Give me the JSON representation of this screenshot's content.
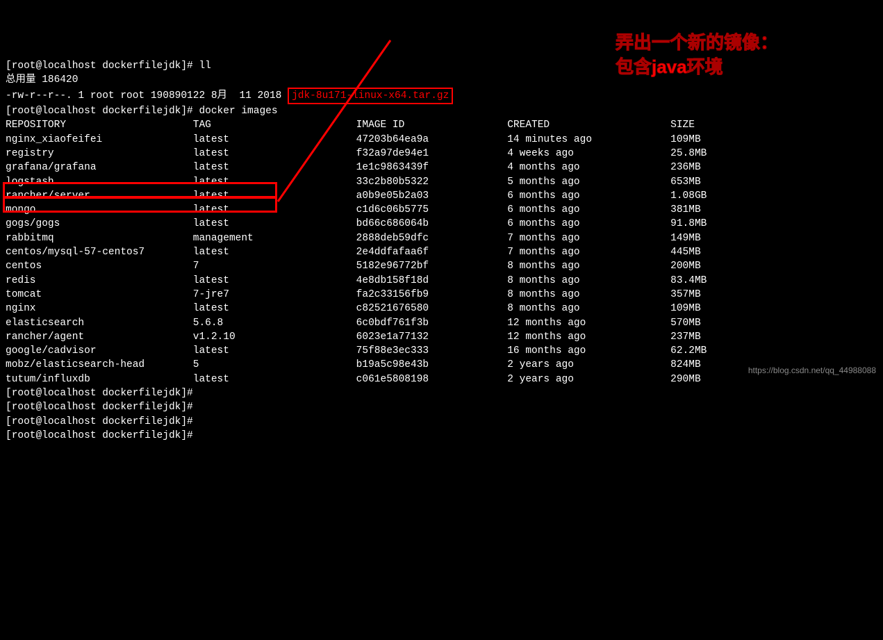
{
  "prompt1": "[root@localhost dockerfilejdk]# ",
  "cmd1": "ll",
  "total_line": "总用量 186420",
  "file_line_pre": "-rw-r--r--. 1 root root 190890122 8月  11 2018 ",
  "highlighted_file": "jdk-8u171-linux-x64.tar.gz",
  "prompt2": "[root@localhost dockerfilejdk]# ",
  "cmd2": "docker images",
  "header": {
    "col1": "REPOSITORY",
    "col2": "TAG",
    "col3": "IMAGE ID",
    "col4": "CREATED",
    "col5": "SIZE"
  },
  "images": [
    {
      "repo": "nginx_xiaofeifei",
      "tag": "latest",
      "id": "47203b64ea9a",
      "created": "14 minutes ago",
      "size": "109MB"
    },
    {
      "repo": "registry",
      "tag": "latest",
      "id": "f32a97de94e1",
      "created": "4 weeks ago",
      "size": "25.8MB"
    },
    {
      "repo": "grafana/grafana",
      "tag": "latest",
      "id": "1e1c9863439f",
      "created": "4 months ago",
      "size": "236MB"
    },
    {
      "repo": "logstash",
      "tag": "latest",
      "id": "33c2b80b5322",
      "created": "5 months ago",
      "size": "653MB"
    },
    {
      "repo": "rancher/server",
      "tag": "latest",
      "id": "a0b9e05b2a03",
      "created": "6 months ago",
      "size": "1.08GB"
    },
    {
      "repo": "mongo",
      "tag": "latest",
      "id": "c1d6c06b5775",
      "created": "6 months ago",
      "size": "381MB"
    },
    {
      "repo": "gogs/gogs",
      "tag": "latest",
      "id": "bd66c686064b",
      "created": "6 months ago",
      "size": "91.8MB"
    },
    {
      "repo": "rabbitmq",
      "tag": "management",
      "id": "2888deb59dfc",
      "created": "7 months ago",
      "size": "149MB"
    },
    {
      "repo": "centos/mysql-57-centos7",
      "tag": "latest",
      "id": "2e4ddfafaa6f",
      "created": "7 months ago",
      "size": "445MB"
    },
    {
      "repo": "centos",
      "tag": "7",
      "id": "5182e96772bf",
      "created": "8 months ago",
      "size": "200MB"
    },
    {
      "repo": "redis",
      "tag": "latest",
      "id": "4e8db158f18d",
      "created": "8 months ago",
      "size": "83.4MB"
    },
    {
      "repo": "tomcat",
      "tag": "7-jre7",
      "id": "fa2c33156fb9",
      "created": "8 months ago",
      "size": "357MB"
    },
    {
      "repo": "nginx",
      "tag": "latest",
      "id": "c82521676580",
      "created": "8 months ago",
      "size": "109MB"
    },
    {
      "repo": "elasticsearch",
      "tag": "5.6.8",
      "id": "6c0bdf761f3b",
      "created": "12 months ago",
      "size": "570MB"
    },
    {
      "repo": "rancher/agent",
      "tag": "v1.2.10",
      "id": "6023e1a77132",
      "created": "12 months ago",
      "size": "237MB"
    },
    {
      "repo": "google/cadvisor",
      "tag": "latest",
      "id": "75f88e3ec333",
      "created": "16 months ago",
      "size": "62.2MB"
    },
    {
      "repo": "mobz/elasticsearch-head",
      "tag": "5",
      "id": "b19a5c98e43b",
      "created": "2 years ago",
      "size": "824MB"
    },
    {
      "repo": "tutum/influxdb",
      "tag": "latest",
      "id": "c061e5808198",
      "created": "2 years ago",
      "size": "290MB"
    }
  ],
  "trailing_prompts": [
    "[root@localhost dockerfilejdk]#",
    "[root@localhost dockerfilejdk]#",
    "[root@localhost dockerfilejdk]#",
    "[root@localhost dockerfilejdk]#"
  ],
  "annotation_line1": "弄出一个新的镜像：",
  "annotation_line2": "包含java环境",
  "watermark": "https://blog.csdn.net/qq_44988088"
}
